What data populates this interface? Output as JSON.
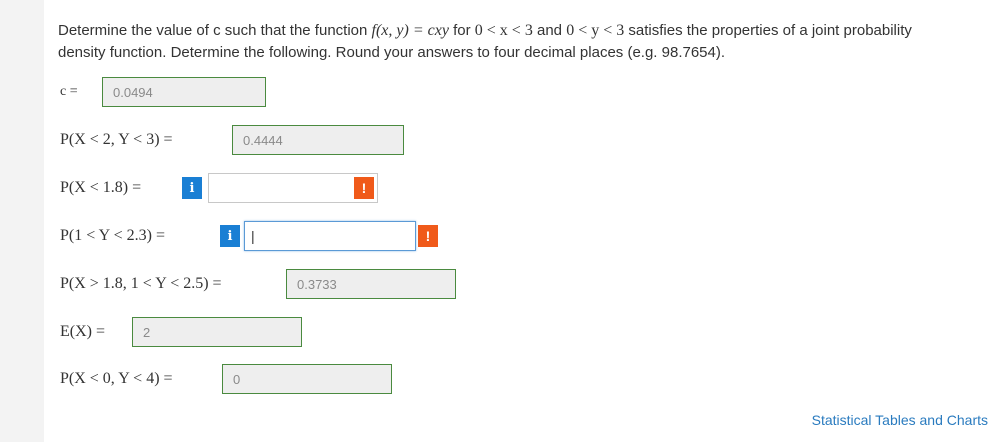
{
  "question": {
    "intro": "Determine the value of c such that the function ",
    "function": "f(x, y) = cxy",
    "for": " for ",
    "x_range": "0 < x < 3",
    "and": " and ",
    "y_range": "0 < y < 3",
    "rest": " satisfies the properties of a joint probability density function. Determine the following. Round your answers to four decimal places (e.g. 98.7654)."
  },
  "rows": [
    {
      "label": "c =",
      "value": "0.0494"
    },
    {
      "label": "P(X < 2, Y < 3) =",
      "value": "0.4444"
    },
    {
      "label": "P(X < 1.8) =",
      "info": "i",
      "value": "",
      "warning": "!"
    },
    {
      "label": "P(1 < Y < 2.3) =",
      "info": "i",
      "value": "|",
      "warning": "!"
    },
    {
      "label": "P(X > 1.8, 1 < Y < 2.5) =",
      "value": "0.3733"
    },
    {
      "label": "E(X) =",
      "value": "2"
    },
    {
      "label": "P(X < 0, Y < 4) =",
      "value": "0"
    }
  ],
  "footer": {
    "link": "Statistical Tables and Charts"
  },
  "colors": {
    "correct_border": "#4a8a3f",
    "info": "#1a7fd4",
    "warning": "#f05a1a",
    "link": "#2a7bbf"
  }
}
